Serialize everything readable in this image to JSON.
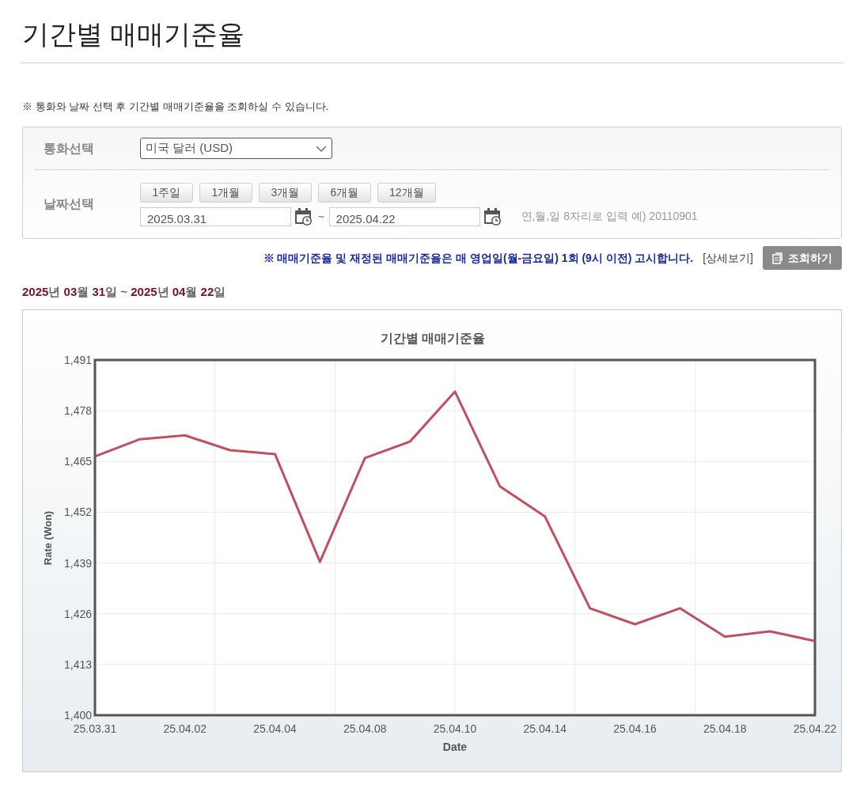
{
  "page_title": "기간별 매매기준율",
  "notice": "※ 통화와 날짜 선택 후 기간별 매매기준율을 조회하실 수 있습니다.",
  "form": {
    "currency_label": "통화선택",
    "currency_select": "미국 달러 (USD)",
    "date_label": "날짜선택",
    "period_buttons": [
      "1주일",
      "1개월",
      "3개월",
      "6개월",
      "12개월"
    ],
    "start_date": "2025.03.31",
    "separator": "~",
    "end_date": "2025.04.22",
    "date_hint": "연,월,일 8자리로 입력 예) 20110901"
  },
  "announcement": "※ 매매기준율 및 재정된 매매기준율은 매 영업일(월-금요일) 1회 (9시 이전) 고시합니다.",
  "detail_link": "[상세보기]",
  "search_button": "조회하기",
  "date_range": "**2025**년 **03**월 **31**일 ~ **2025**년 **04**월 **22**일",
  "chart": {
    "chart_data": {
      "type": "line",
      "title": "기간별 매매기준율",
      "xlabel": "Date",
      "ylabel": "Rate (Won)",
      "grid": true,
      "categories": [
        "25.03.31",
        null,
        "25.04.02",
        null,
        "25.04.04",
        null,
        "25.04.08",
        null,
        "25.04.10",
        null,
        "25.04.14",
        null,
        "25.04.16",
        null,
        "25.04.18",
        null,
        "25.04.22"
      ],
      "series": [
        {
          "color": "#c0505f",
          "values": [
            1466.3,
            1470.7,
            1471.7,
            1467.9,
            1466.9,
            1439.3,
            1465.9,
            1470.1,
            1482.9,
            1458.6,
            1450.9,
            1427.4,
            1423.3,
            1427.4,
            1420.1,
            1421.5,
            1419.0
          ]
        }
      ],
      "ylim": [
        1400,
        1491
      ],
      "yticks": [
        {
          "value": 1400,
          "label": "1,400"
        },
        {
          "value": 1413,
          "label": "1,413"
        },
        {
          "value": 1426,
          "label": "1,426"
        },
        {
          "value": 1439,
          "label": "1,439"
        },
        {
          "value": 1452,
          "label": "1,452"
        },
        {
          "value": 1465,
          "label": "1,465"
        },
        {
          "value": 1478,
          "label": "1,478"
        },
        {
          "value": 1491,
          "label": "1,491"
        }
      ]
    }
  }
}
